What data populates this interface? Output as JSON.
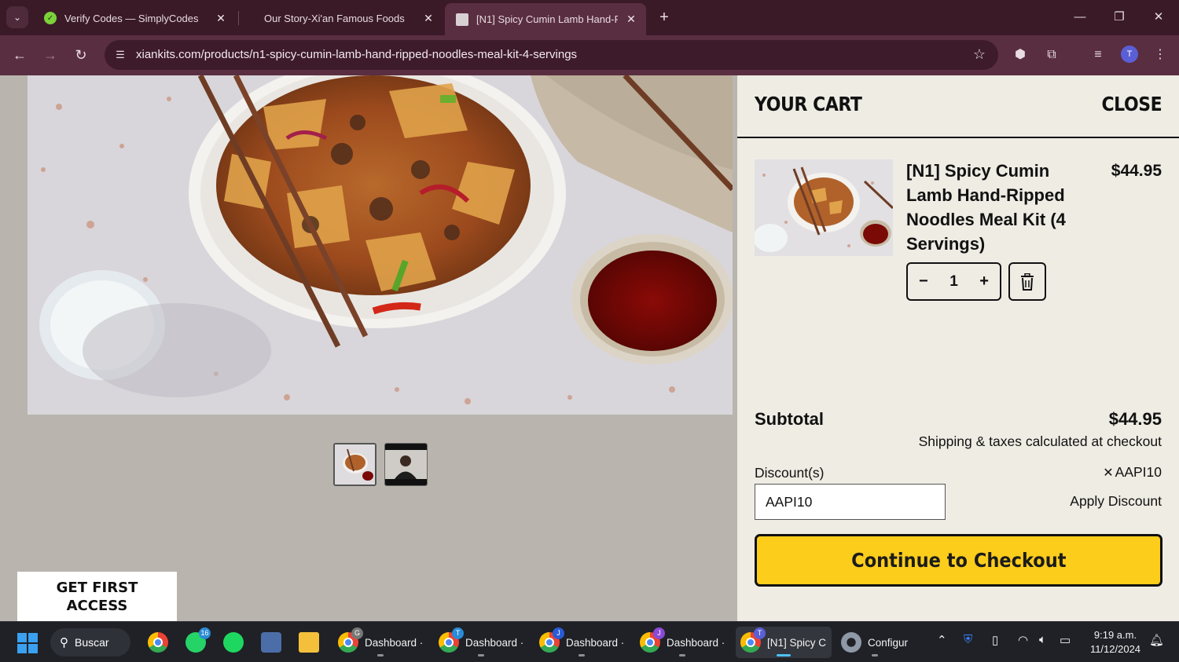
{
  "browser": {
    "tabs": [
      {
        "title": "Verify Codes — SimplyCodes",
        "active": false
      },
      {
        "title": "Our Story-Xi'an Famous Foods",
        "active": false
      },
      {
        "title": "[N1] Spicy Cumin Lamb Hand-R",
        "active": true
      }
    ],
    "url": "xiankits.com/products/n1-spicy-cumin-lamb-hand-ripped-noodles-meal-kit-4-servings",
    "profile_initial": "T"
  },
  "page": {
    "promo_banner": "GET FIRST ACCESS"
  },
  "cart": {
    "title": "YOUR CART",
    "close_label": "CLOSE",
    "item": {
      "name": "[N1] Spicy Cumin Lamb Hand-Ripped Noodles Meal Kit (4 Servings)",
      "price": "$44.95",
      "quantity": "1",
      "minus": "−",
      "plus": "+"
    },
    "subtotal_label": "Subtotal",
    "subtotal_value": "$44.95",
    "shipping_note": "Shipping & taxes calculated at checkout",
    "discount_label": "Discount(s)",
    "applied_discount": "AAPI10",
    "discount_input_value": "AAPI10",
    "apply_discount_label": "Apply Discount",
    "checkout_label": "Continue to Checkout"
  },
  "taskbar": {
    "search_label": "Buscar",
    "apps": [
      {
        "label": "Dashboard ·",
        "badge": "G"
      },
      {
        "label": "Dashboard ·",
        "badge": "T"
      },
      {
        "label": "Dashboard ·",
        "badge": "J"
      },
      {
        "label": "Dashboard ·",
        "badge": "J"
      },
      {
        "label": "[N1] Spicy C",
        "badge": "T"
      },
      {
        "label": "Configur",
        "badge": ""
      }
    ],
    "whatsapp_badge": "16",
    "time": "9:19 a.m.",
    "date": "11/12/2024"
  },
  "colors": {
    "accent": "#fccd1b",
    "drawer_bg": "#efece4",
    "chrome_dark": "#3b1a28",
    "chrome_toolbar": "#5a2e41"
  }
}
